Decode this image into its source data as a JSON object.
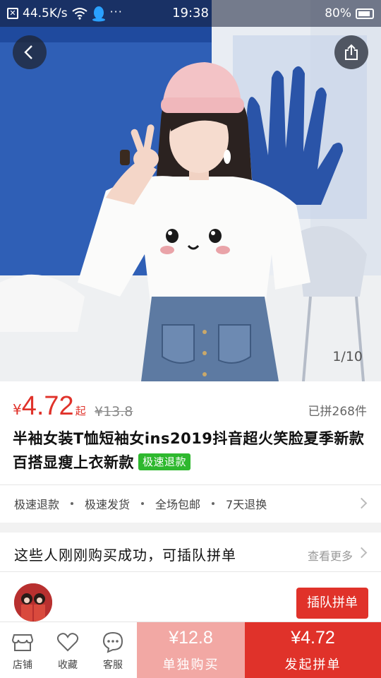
{
  "status_bar": {
    "speed": "44.5K/s",
    "dots": "···",
    "time": "19:38",
    "battery": "80%"
  },
  "gallery": {
    "indicator": "1/10"
  },
  "product": {
    "currency": "¥",
    "price": "4.72",
    "price_suffix": "起",
    "original_price": "¥13.8",
    "sold": "已拼268件",
    "title": "半袖女装T恤短袖女ins2019抖音超火笑脸夏季新款百搭显瘦上衣新款",
    "refund_badge": "极速退款"
  },
  "services": [
    "极速退款",
    "极速发货",
    "全场包邮",
    "7天退换"
  ],
  "group_queue": {
    "heading": "这些人刚刚购买成功，可插队拼单",
    "more": "查看更多",
    "jump_button": "插队拼单"
  },
  "bottom_bar": {
    "store": "店铺",
    "favorite": "收藏",
    "service": "客服",
    "single_price": "¥12.8",
    "single_label": "单独购买",
    "group_price": "¥4.72",
    "group_label": "发起拼单"
  },
  "colors": {
    "accent_red": "#e0322a",
    "light_red": "#f2a8a4",
    "badge_green": "#2eb82e"
  }
}
